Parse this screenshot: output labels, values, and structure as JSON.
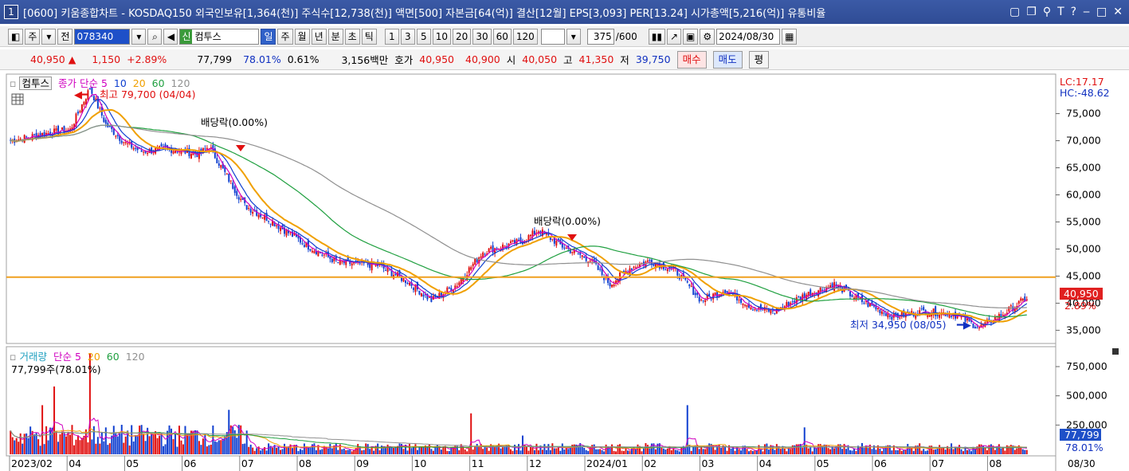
{
  "title": {
    "num": "1",
    "text": "[0600] 키움종합차트 - KOSDAQ150 외국인보유[1,364(천)] 주식수[12,738(천)] 액면[500] 자본금[64(억)] 결산[12월] EPS[3,093] PER[13.24] 시가총액[5,216(억)] 유통비율"
  },
  "toolbar": {
    "type_label": "주",
    "jeon_label": "전",
    "code": "078340",
    "stock_name": "컴투스",
    "sin_label": "신",
    "periods": [
      "일",
      "주",
      "월",
      "년",
      "분",
      "초",
      "틱"
    ],
    "selected_period": "일",
    "intervals": [
      "1",
      "3",
      "5",
      "10",
      "20",
      "30",
      "60",
      "120"
    ],
    "count": "375",
    "total": "/600",
    "date": "2024/08/30"
  },
  "quote": {
    "price": "40,950 ▲",
    "change": "1,150",
    "change_pct": "+2.89%",
    "volume": "77,799",
    "vol_ratio": "78.01%",
    "turnover": "0.61%",
    "amount": "3,156백만",
    "hoga_label": "호가",
    "ask": "40,950",
    "bid": "40,900",
    "open_label": "시",
    "open": "40,050",
    "high_label": "고",
    "high": "41,350",
    "low_label": "저",
    "low": "39,750",
    "buy_label": "매수",
    "sell_label": "매도",
    "flat_label": "평"
  },
  "price_panel": {
    "legend_name": "컴투스",
    "legend_close": "종가 단순",
    "ma_periods": [
      "5",
      "10",
      "20",
      "60",
      "120"
    ],
    "ma_colors": [
      "#d000c0",
      "#1040d0",
      "#f0a000",
      "#20a040",
      "#909090"
    ],
    "high_note": "최고 79,700 (04/04)",
    "low_note": "최저 34,950 (08/05)",
    "dividend1": "배당락(0.00%)",
    "dividend2": "배당락(0.00%)",
    "lc": "LC:17.17",
    "hc": "HC:-48.62",
    "cur_price": "40,950",
    "cur_pct": "2.89%",
    "hline_value": 44800,
    "y_ticks": [
      "75,000",
      "70,000",
      "65,000",
      "60,000",
      "55,000",
      "50,000",
      "45,000",
      "40,000",
      "35,000"
    ],
    "y_tick_values": [
      75000,
      70000,
      65000,
      60000,
      55000,
      50000,
      45000,
      40000,
      35000
    ]
  },
  "volume_panel": {
    "legend_name": "거래량",
    "legend_close": "단순",
    "ma_periods": [
      "5",
      "20",
      "60",
      "120"
    ],
    "note": "77,799주(78.01%)",
    "cur_vol": "77,799",
    "cur_pct": "78.01%",
    "y_ticks": [
      "750,000",
      "500,000",
      "250,000"
    ],
    "y_tick_values": [
      750000,
      500000,
      250000
    ]
  },
  "x_axis": {
    "labels": [
      "2023/02",
      "04",
      "05",
      "06",
      "07",
      "08",
      "09",
      "10",
      "11",
      "12",
      "2024/01",
      "02",
      "03",
      "04",
      "05",
      "06",
      "07",
      "08"
    ],
    "end_label": "08/30"
  },
  "chart_data": {
    "type": "candlestick",
    "price_keypoints": [
      {
        "t": 0,
        "p": 70000
      },
      {
        "t": 20,
        "p": 71500
      },
      {
        "t": 30,
        "p": 72000
      },
      {
        "t": 40,
        "p": 79700
      },
      {
        "t": 48,
        "p": 73000
      },
      {
        "t": 58,
        "p": 69500
      },
      {
        "t": 66,
        "p": 68000
      },
      {
        "t": 80,
        "p": 68500
      },
      {
        "t": 95,
        "p": 67500
      },
      {
        "t": 100,
        "p": 69000
      },
      {
        "t": 108,
        "p": 64000
      },
      {
        "t": 118,
        "p": 58000
      },
      {
        "t": 130,
        "p": 55500
      },
      {
        "t": 150,
        "p": 50500
      },
      {
        "t": 165,
        "p": 47500
      },
      {
        "t": 185,
        "p": 47000
      },
      {
        "t": 200,
        "p": 44000
      },
      {
        "t": 212,
        "p": 40500
      },
      {
        "t": 225,
        "p": 43500
      },
      {
        "t": 238,
        "p": 49500
      },
      {
        "t": 258,
        "p": 51500
      },
      {
        "t": 266,
        "p": 53500
      },
      {
        "t": 278,
        "p": 50500
      },
      {
        "t": 292,
        "p": 48000
      },
      {
        "t": 302,
        "p": 43500
      },
      {
        "t": 312,
        "p": 46500
      },
      {
        "t": 322,
        "p": 47800
      },
      {
        "t": 335,
        "p": 46000
      },
      {
        "t": 348,
        "p": 40500
      },
      {
        "t": 360,
        "p": 42500
      },
      {
        "t": 375,
        "p": 39000
      },
      {
        "t": 385,
        "p": 38500
      },
      {
        "t": 400,
        "p": 41500
      },
      {
        "t": 415,
        "p": 43500
      },
      {
        "t": 428,
        "p": 40500
      },
      {
        "t": 445,
        "p": 37500
      },
      {
        "t": 460,
        "p": 38500
      },
      {
        "t": 475,
        "p": 38000
      },
      {
        "t": 488,
        "p": 35500
      },
      {
        "t": 500,
        "p": 38000
      },
      {
        "t": 512,
        "p": 40950
      }
    ],
    "volume_spikes": [
      {
        "t": 40,
        "v": 860000
      },
      {
        "t": 22,
        "v": 580000
      },
      {
        "t": 16,
        "v": 420000
      },
      {
        "t": 110,
        "v": 380000
      },
      {
        "t": 232,
        "v": 350000
      },
      {
        "t": 341,
        "v": 420000
      },
      {
        "t": 400,
        "v": 230000
      },
      {
        "t": 258,
        "v": 160000
      }
    ],
    "ylim_price": [
      33000,
      82000
    ],
    "ylim_volume": [
      0,
      900000
    ]
  }
}
